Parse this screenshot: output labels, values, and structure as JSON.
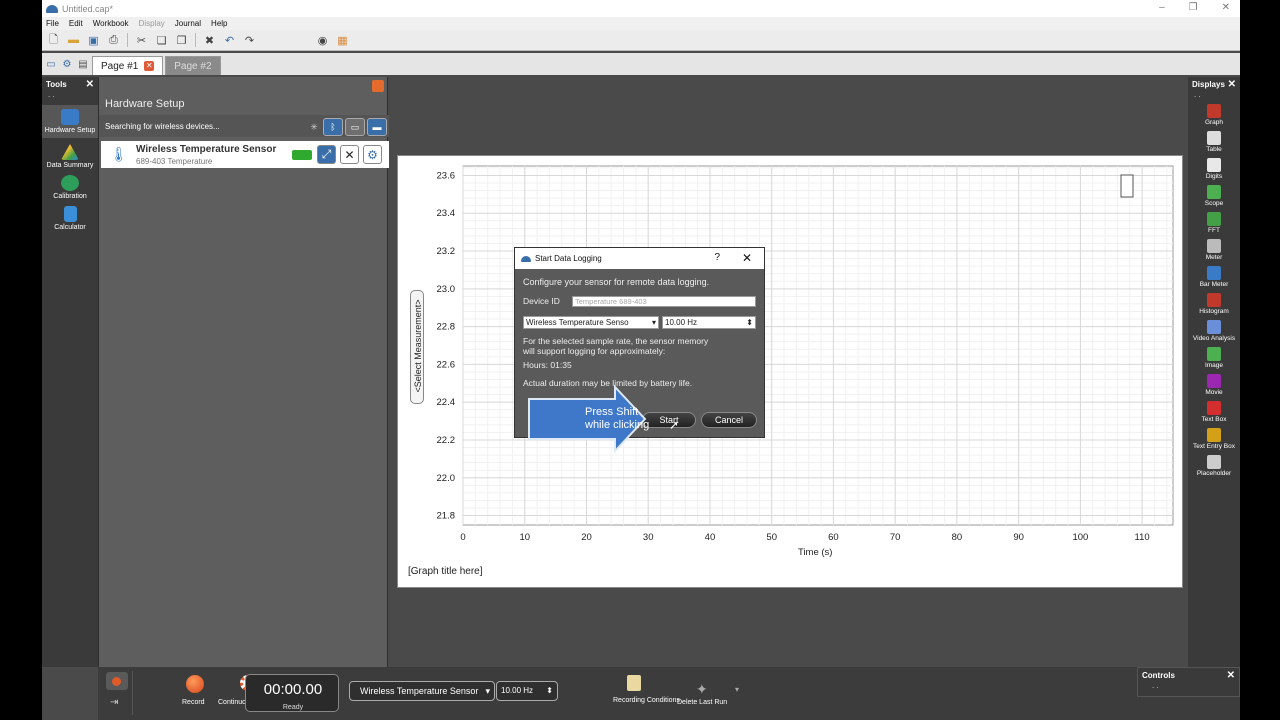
{
  "window": {
    "title": "Untitled.cap*"
  },
  "menu": {
    "items": [
      "File",
      "Edit",
      "Workbook",
      "Display",
      "Journal",
      "Help"
    ]
  },
  "tabs": [
    {
      "label": "Page #1",
      "active": true
    },
    {
      "label": "Page #2",
      "active": false
    }
  ],
  "tools": {
    "header": "Tools",
    "items": [
      {
        "label": "Hardware Setup",
        "icon": "hardware-icon"
      },
      {
        "label": "Data Summary",
        "icon": "data-summary-icon"
      },
      {
        "label": "Calibration",
        "icon": "calibration-icon"
      },
      {
        "label": "Calculator",
        "icon": "calculator-icon"
      }
    ]
  },
  "hardware": {
    "title": "Hardware Setup",
    "status": "Searching for wireless devices...",
    "sensor": {
      "name": "Wireless Temperature Sensor",
      "sub": "689-403 Temperature"
    }
  },
  "graph": {
    "ylabel_button": "<Select Measurement>",
    "title_placeholder": "[Graph title here]"
  },
  "chart_data": {
    "type": "line",
    "xlabel": "Time (s)",
    "ylabel": "<Select Measurement>",
    "xlim": [
      0,
      115
    ],
    "ylim": [
      21.75,
      23.65
    ],
    "x_ticks": [
      0,
      10,
      20,
      30,
      40,
      50,
      60,
      70,
      80,
      90,
      100,
      110
    ],
    "y_ticks": [
      21.8,
      22.0,
      22.2,
      22.4,
      22.6,
      22.8,
      23.0,
      23.2,
      23.4,
      23.6
    ],
    "grid": true,
    "series": []
  },
  "dialog": {
    "title": "Start Data Logging",
    "help": "?",
    "intro": "Configure your sensor for remote data logging.",
    "device_id_label": "Device ID",
    "device_id_placeholder": "Temperature 689-403",
    "sensor_select": "Wireless Temperature Senso",
    "rate": "10.00 Hz",
    "memory_text_1": "For the selected sample rate, the sensor memory",
    "memory_text_2": "will support logging for approximately:",
    "hours": "Hours: 01:35",
    "battery_note": "Actual duration may be limited by battery life.",
    "start": "Start",
    "cancel": "Cancel"
  },
  "callout": {
    "line1": "Press Shift",
    "line2": "while clicking"
  },
  "displays": {
    "header": "Displays",
    "items": [
      {
        "label": "Graph",
        "color": "#c0392b"
      },
      {
        "label": "Table",
        "color": "#dddddd"
      },
      {
        "label": "Digits",
        "color": "#e8e8e8"
      },
      {
        "label": "Scope",
        "color": "#4caf50"
      },
      {
        "label": "FFT",
        "color": "#43a047"
      },
      {
        "label": "Meter",
        "color": "#bbbbbb"
      },
      {
        "label": "Bar Meter",
        "color": "#3a7bc8"
      },
      {
        "label": "Histogram",
        "color": "#c0392b"
      },
      {
        "label": "Video Analysis",
        "color": "#6a8fd8"
      },
      {
        "label": "Image",
        "color": "#4caf50"
      },
      {
        "label": "Movie",
        "color": "#9c27b0"
      },
      {
        "label": "Text Box",
        "color": "#d32f2f"
      },
      {
        "label": "Text Entry Box",
        "color": "#d4a017"
      },
      {
        "label": "Placeholder",
        "color": "#cccccc"
      }
    ]
  },
  "bottom": {
    "record": "Record",
    "mode": "Continuous Mode",
    "timer": "00:00.00",
    "status": "Ready",
    "sensor": "Wireless Temperature Sensor",
    "rate": "10.00 Hz",
    "recording_conditions": "Recording Conditions",
    "delete_last_run": "Delete Last Run",
    "controls": "Controls"
  },
  "colors": {
    "accent": "#3a6ea8",
    "callout": "#3f78c9",
    "battery": "#2faa2f",
    "record": "#e05a2a"
  }
}
